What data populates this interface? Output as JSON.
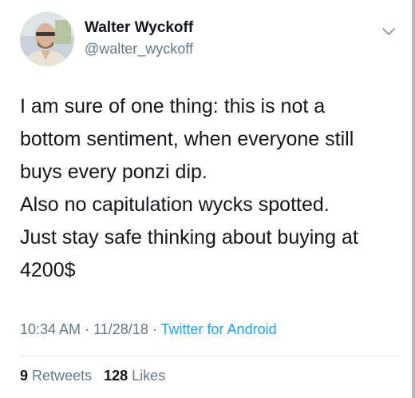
{
  "user": {
    "name": "Walter Wyckoff",
    "handle": "@walter_wyckoff"
  },
  "tweet": {
    "lines": [
      "I am sure of one thing: this is not a",
      "bottom sentiment, when everyone still",
      "buys every ponzi dip.",
      "Also no capitulation wycks spotted.",
      "Just stay safe thinking about buying at",
      "4200$"
    ],
    "time": "10:34 AM",
    "separator": "·",
    "date": "11/28/18",
    "source": "Twitter for Android"
  },
  "stats": {
    "retweets_count": "9",
    "retweets_label": "Retweets",
    "likes_count": "128",
    "likes_label": "Likes"
  },
  "icons": {
    "menu": "chevron-down-icon"
  },
  "colors": {
    "link": "#1da1f2",
    "secondary": "#657786",
    "text": "#14171a"
  }
}
